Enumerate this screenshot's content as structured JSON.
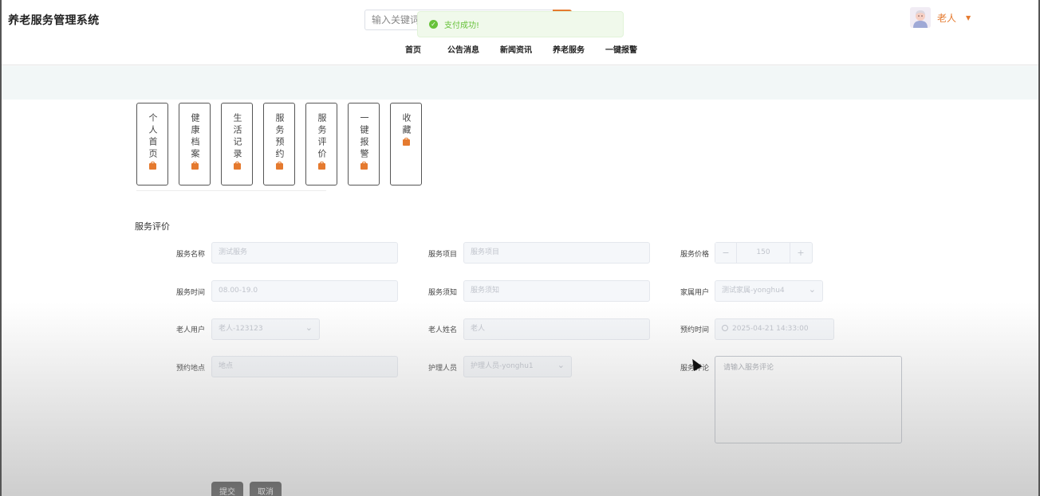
{
  "app": {
    "title": "养老服务管理系统"
  },
  "search": {
    "placeholder": "输入关键词"
  },
  "toast": {
    "message": "支付成功!"
  },
  "nav": {
    "items": [
      "首页",
      "公告消息",
      "新闻资讯",
      "养老服务",
      "一键报警"
    ]
  },
  "user": {
    "name": "老人"
  },
  "menu": {
    "cards": [
      {
        "label": "个人首页"
      },
      {
        "label": "健康档案"
      },
      {
        "label": "生活记录"
      },
      {
        "label": "服务预约"
      },
      {
        "label": "服务评价"
      },
      {
        "label": "一键报警"
      },
      {
        "label": "收藏"
      }
    ]
  },
  "form": {
    "section_title": "服务评价",
    "service_name": {
      "label": "服务名称",
      "value": "测试服务"
    },
    "service_item": {
      "label": "服务项目",
      "value": "服务项目"
    },
    "service_price": {
      "label": "服务价格",
      "value": "150"
    },
    "service_time": {
      "label": "服务时间",
      "value": "08.00-19.0"
    },
    "service_notice": {
      "label": "服务须知",
      "value": "服务须知"
    },
    "family_user": {
      "label": "家属用户",
      "value": "测试家属-yonghu4"
    },
    "elder_user": {
      "label": "老人用户",
      "value": "老人-123123"
    },
    "elder_name": {
      "label": "老人姓名",
      "value": "老人"
    },
    "booking_time": {
      "label": "预约时间",
      "value": "2025-04-21 14:33:00"
    },
    "booking_place": {
      "label": "预约地点",
      "value": "地点"
    },
    "caregiver": {
      "label": "护理人员",
      "value": "护理人员-yonghu1"
    },
    "service_review": {
      "label": "服务评论",
      "placeholder": "请输入服务评论"
    },
    "submit_label": "提交",
    "cancel_label": "取消"
  },
  "colors": {
    "accent": "#e57a2f",
    "success": "#67c23a",
    "button": "#303030"
  }
}
